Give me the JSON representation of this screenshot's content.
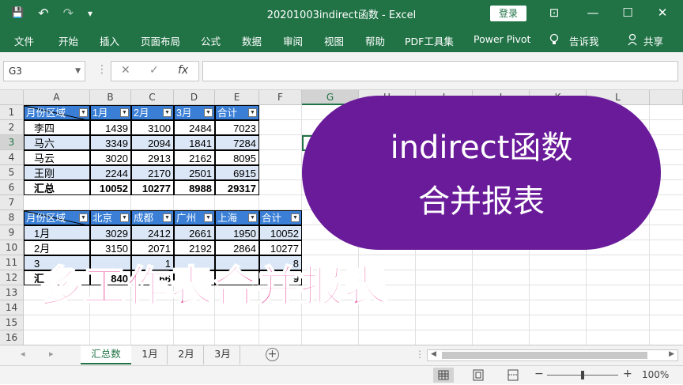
{
  "window": {
    "title": "20201003indirect函数 - Excel",
    "login_label": "登录",
    "qat": {
      "save": "💾",
      "undo": "↶",
      "redo": "↷",
      "customize": "▾"
    },
    "controls": {
      "ribbon_options": "⊡",
      "minimize": "—",
      "maximize": "☐",
      "close": "✕"
    }
  },
  "ribbon": {
    "tabs": [
      "文件",
      "开始",
      "插入",
      "页面布局",
      "公式",
      "数据",
      "审阅",
      "视图",
      "帮助",
      "PDF工具集",
      "Power Pivot",
      "告诉我",
      "共享"
    ],
    "tell_me_icon": "lightbulb-icon",
    "share_icon": "person-icon"
  },
  "formula_bar": {
    "name_box": "G3",
    "cancel": "✕",
    "enter": "✓",
    "fx": "fx",
    "formula": ""
  },
  "columns": [
    "A",
    "B",
    "C",
    "D",
    "E",
    "F",
    "G",
    "H",
    "I",
    "J",
    "K",
    "L"
  ],
  "rows": [
    "1",
    "2",
    "3",
    "4",
    "5",
    "6",
    "7",
    "8",
    "9",
    "10",
    "11",
    "12",
    "13",
    "14",
    "15",
    "16"
  ],
  "table1": {
    "headers": [
      "月份区域",
      "1月",
      "2月",
      "3月",
      "合计"
    ],
    "rows": [
      [
        "李四",
        "1439",
        "3100",
        "2484",
        "7023"
      ],
      [
        "马六",
        "3349",
        "2094",
        "1841",
        "7284"
      ],
      [
        "马云",
        "3020",
        "2913",
        "2162",
        "8095"
      ],
      [
        "王刚",
        "2244",
        "2170",
        "2501",
        "6915"
      ],
      [
        "汇总",
        "10052",
        "10277",
        "8988",
        "29317"
      ]
    ]
  },
  "table2": {
    "headers": [
      "月份区域",
      "北京",
      "成都",
      "广州",
      "上海",
      "合计"
    ],
    "rows": [
      [
        "1月",
        "3029",
        "2412",
        "2661",
        "1950",
        "10052"
      ],
      [
        "2月",
        "3150",
        "2071",
        "2192",
        "2864",
        "10277"
      ],
      [
        "3",
        "",
        "1",
        "",
        "",
        "8"
      ],
      [
        "汇",
        "840",
        "66",
        "",
        "",
        "9"
      ]
    ]
  },
  "overlay": {
    "promo_line1": "indirect函数",
    "promo_line2": "合并报表",
    "banner": "多工作表合并报表"
  },
  "sheets": {
    "tabs": [
      "汇总数",
      "1月",
      "2月",
      "3月"
    ],
    "active": "汇总数",
    "add": "+",
    "nav_prev": "◂",
    "nav_next": "▸",
    "more": "⋮"
  },
  "status": {
    "zoom": "100%",
    "zoom_out": "−",
    "zoom_in": "+",
    "zoom_level": 0.5
  }
}
